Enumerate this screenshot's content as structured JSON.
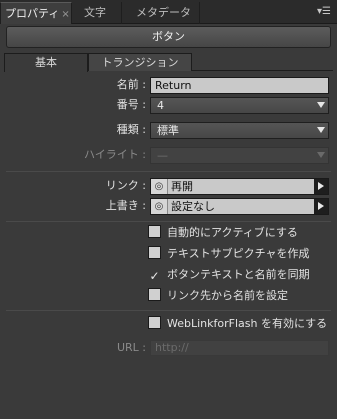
{
  "tabs": [
    {
      "label": "プロパティ",
      "close": "×"
    },
    {
      "label": "文字"
    },
    {
      "label": "メタデータ"
    }
  ],
  "panel_menu_icon": "panel-menu-icon",
  "header": {
    "title": "ボタン"
  },
  "subtabs": [
    {
      "label": "基本"
    },
    {
      "label": "トランジション"
    }
  ],
  "props": {
    "name": {
      "label": "名前 :",
      "value": "Return"
    },
    "number": {
      "label": "番号 :",
      "value": "4"
    },
    "type": {
      "label": "種類 :",
      "value": "標準"
    },
    "highlight": {
      "label": "ハイライト :",
      "value": "—"
    }
  },
  "links": {
    "link": {
      "label": "リンク :",
      "value": "再開"
    },
    "overwrite": {
      "label": "上書き :",
      "value": "設定なし"
    }
  },
  "checkboxes": [
    {
      "label": "自動的にアクティブにする",
      "checked": false
    },
    {
      "label": "テキストサブピクチャを作成",
      "checked": false
    },
    {
      "label": "ボタンテキストと名前を同期",
      "checked": true
    },
    {
      "label": "リンク先から名前を設定",
      "checked": false
    }
  ],
  "weblink": {
    "label": "WebLinkforFlash を有効にする",
    "checked": false
  },
  "url": {
    "label": "URL :",
    "placeholder": "http://"
  },
  "colors": {
    "panel_bg": "#3a3a3a",
    "tab_bg": "#2b2b2b",
    "field_bg": "#c9c9c9"
  }
}
